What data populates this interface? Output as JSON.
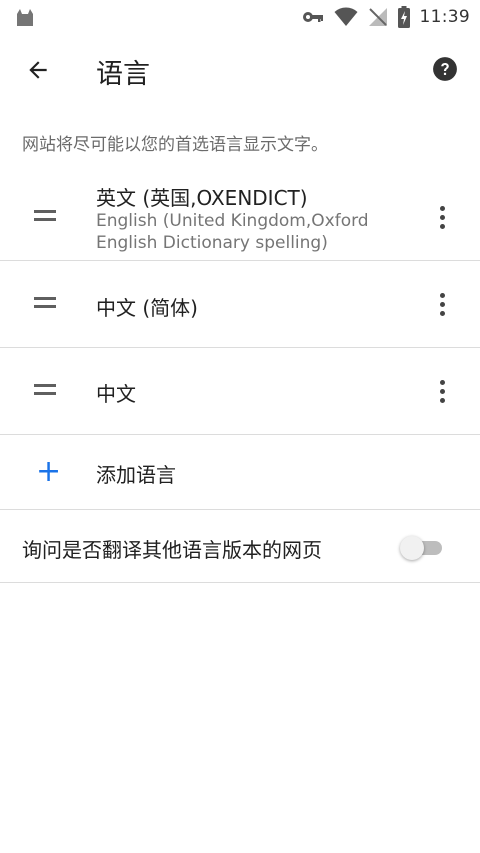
{
  "status_bar": {
    "time": "11:39",
    "icons": [
      "cat-app-icon",
      "key-icon",
      "wifi-icon",
      "no-signal-icon",
      "battery-charging-icon"
    ]
  },
  "app_bar": {
    "title": "语言",
    "back_icon": "arrow-back-icon",
    "help_icon": "help-icon"
  },
  "description": "网站将尽可能以您的首选语言显示文字。",
  "languages": [
    {
      "title": "英文 (英国,OXENDICT)",
      "subtitle": "English (United Kingdom,Oxford English Dictionary spelling)"
    },
    {
      "title": "中文 (简体)"
    },
    {
      "title": "中文"
    }
  ],
  "add_language": {
    "label": "添加语言",
    "icon": "plus-icon"
  },
  "translate_offer": {
    "label": "询问是否翻译其他语言版本的网页",
    "enabled": false
  },
  "colors": {
    "accent": "#1a73e8",
    "divider": "#dcdcdc",
    "secondary_text": "#757575"
  }
}
